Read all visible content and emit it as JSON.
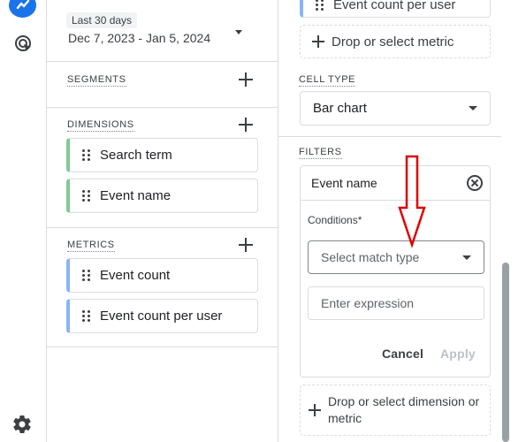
{
  "rail": {
    "top_icon": "insights-icon",
    "second_icon": "explore-target-icon",
    "bottom_icon": "gear-icon"
  },
  "date": {
    "chip": "Last 30 days",
    "range": "Dec 7, 2023 - Jan 5, 2024"
  },
  "segments": {
    "label": "SEGMENTS"
  },
  "dimensions": {
    "label": "DIMENSIONS",
    "items": [
      {
        "label": "Search term"
      },
      {
        "label": "Event name"
      }
    ]
  },
  "metrics": {
    "label": "METRICS",
    "items": [
      {
        "label": "Event count"
      },
      {
        "label": "Event count per user"
      }
    ]
  },
  "settings": {
    "values_item": "Event count per user",
    "drop_metric": "Drop or select metric",
    "cell_type_label": "CELL TYPE",
    "cell_type_value": "Bar chart",
    "filters_label": "FILTERS",
    "filter": {
      "name": "Event name",
      "conditions_label": "Conditions*",
      "match_placeholder": "Select match type",
      "expression_placeholder": "Enter expression",
      "cancel": "Cancel",
      "apply": "Apply"
    },
    "drop_dimension": "Drop or select dimension or metric"
  },
  "colors": {
    "dimension_accent": "#81c995",
    "metric_accent": "#8ab4f8",
    "annotation_arrow": "#e00000"
  }
}
